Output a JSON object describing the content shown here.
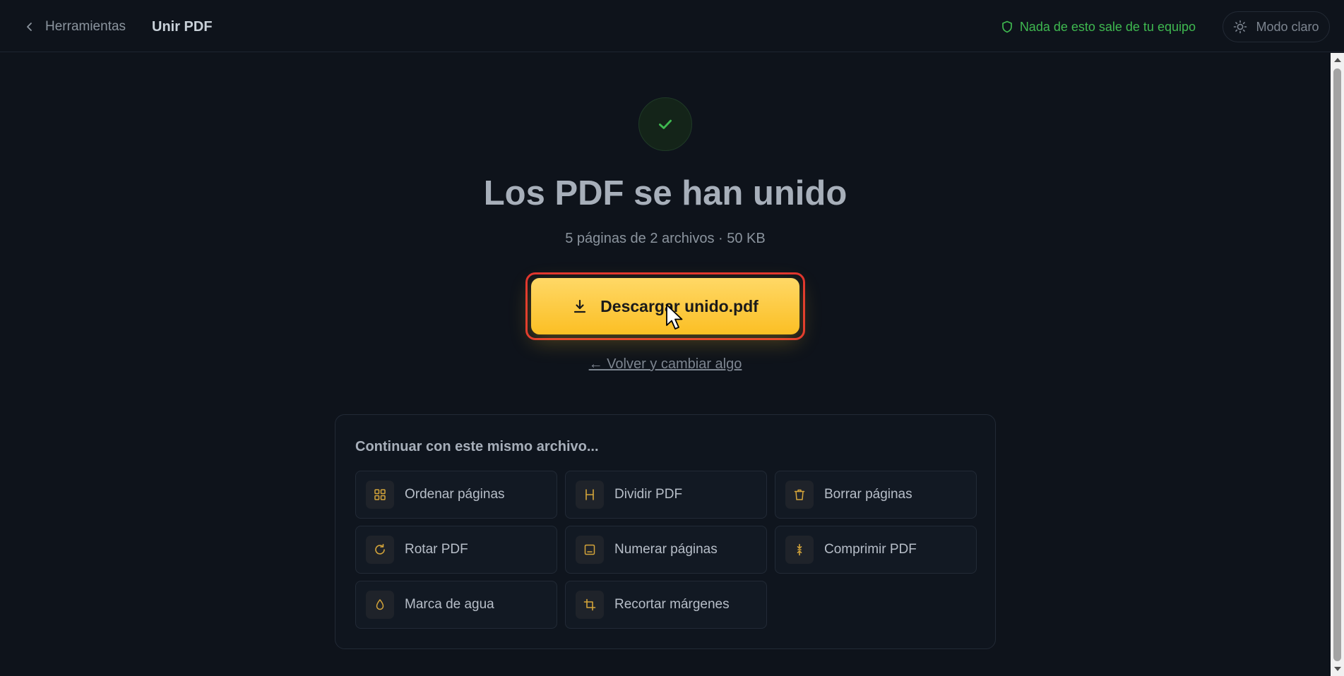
{
  "header": {
    "back_label": "Herramientas",
    "current_tool": "Unir PDF",
    "privacy_text": "Nada de esto sale de tu equipo",
    "theme_label": "Modo claro"
  },
  "result": {
    "title": "Los PDF se han unido",
    "subtitle": "5 páginas de 2 archivos · 50 KB",
    "download_label": "Descargar unido.pdf",
    "back_link": "← Volver y cambiar algo"
  },
  "continue": {
    "title": "Continuar con este mismo archivo...",
    "tools": [
      {
        "label": "Ordenar páginas",
        "icon": "grid-icon"
      },
      {
        "label": "Dividir PDF",
        "icon": "split-icon"
      },
      {
        "label": "Borrar páginas",
        "icon": "trash-icon"
      },
      {
        "label": "Rotar PDF",
        "icon": "rotate-icon"
      },
      {
        "label": "Numerar páginas",
        "icon": "page-number-icon"
      },
      {
        "label": "Comprimir PDF",
        "icon": "compress-icon"
      },
      {
        "label": "Marca de agua",
        "icon": "droplet-icon"
      },
      {
        "label": "Recortar márgenes",
        "icon": "crop-icon"
      }
    ]
  },
  "colors": {
    "background": "#0e131b",
    "accent": "#fbbf24",
    "success": "#3fb950",
    "highlight_ring": "#e0342f"
  }
}
